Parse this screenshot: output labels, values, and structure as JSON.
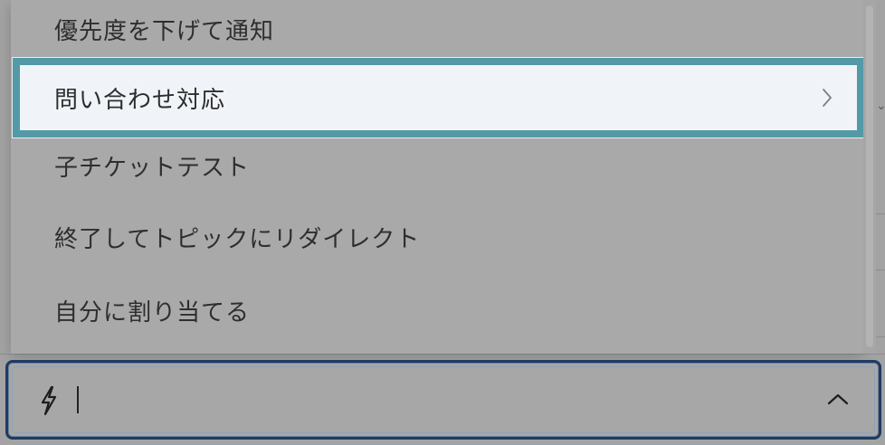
{
  "menu": {
    "items": [
      {
        "label": "優先度を下げて通知",
        "active": false,
        "has_submenu": false
      },
      {
        "label": "問い合わせ対応",
        "active": true,
        "has_submenu": true
      },
      {
        "label": "子チケットテスト",
        "active": false,
        "has_submenu": false
      },
      {
        "label": "終了してトピックにリダイレクト",
        "active": false,
        "has_submenu": false
      },
      {
        "label": "自分に割り当てる",
        "active": false,
        "has_submenu": false
      }
    ],
    "submenu_icon": "chevron-right-icon"
  },
  "trigger": {
    "value": "",
    "leading_icon": "lightning-bolt-icon",
    "trailing_icon": "chevron-up-icon"
  },
  "colors": {
    "overlay": "#a9a9a9",
    "active_bg": "#f0f4f9",
    "active_border": "#5499a6",
    "focus_border": "#1f3a63"
  }
}
